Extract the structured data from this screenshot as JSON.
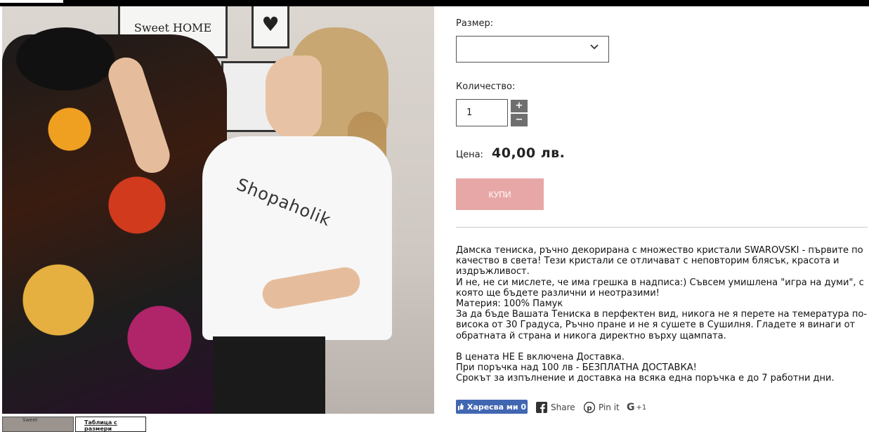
{
  "image": {
    "shirt_print": "Shopaholik",
    "poster_text": "Sweet HOME"
  },
  "thumbnails": {
    "thumb1_text": "Sweet",
    "size_table_label": "Таблица с размери"
  },
  "product": {
    "size_label": "Размер:",
    "size_value": "",
    "quantity_label": "Количество:",
    "quantity_value": "1",
    "qty_plus": "+",
    "qty_minus": "−",
    "price_label": "Цена:",
    "price_value": "40,00 лв.",
    "buy_label": "КУПИ"
  },
  "description": {
    "lines": [
      "Дамска тениска, ръчно декорирана с множество кристали SWAROVSKI - първите по качество в света! Тези кристали се отличават с неповторим блясък, красота и издръжливост.",
      "И не, не си мислете, че има грешка в надписа:) Съвсем умишлена \"игра на думи\", с която ще бъдете различни и неотразими!",
      "Материя: 100% Памук",
      "За да бъде Вашата Тениска в перфектен вид, никога не я перете на темература по-висока от 30 Градуса, Ръчно пране и не я сушете в Сушилня. Гладете я винаги от обратната й страна и никога директно върху щампата.",
      "",
      "В цената НЕ Е включена Доставка.",
      "При поръчка над 100 лв - БЕЗПЛАТНА ДОСТАВКА!",
      "Срокът за изпълнение и доставка на всяка една поръчка е до 7 работни дни."
    ]
  },
  "social": {
    "facebook_label": "Харесва ми 0",
    "share_label": "Share",
    "pinterest_label": "Pin it",
    "gplus_label": "+1"
  },
  "colors": {
    "buy_button": "#e8a7a7",
    "facebook": "#4267b2",
    "qty_button": "#6f6f6f"
  }
}
